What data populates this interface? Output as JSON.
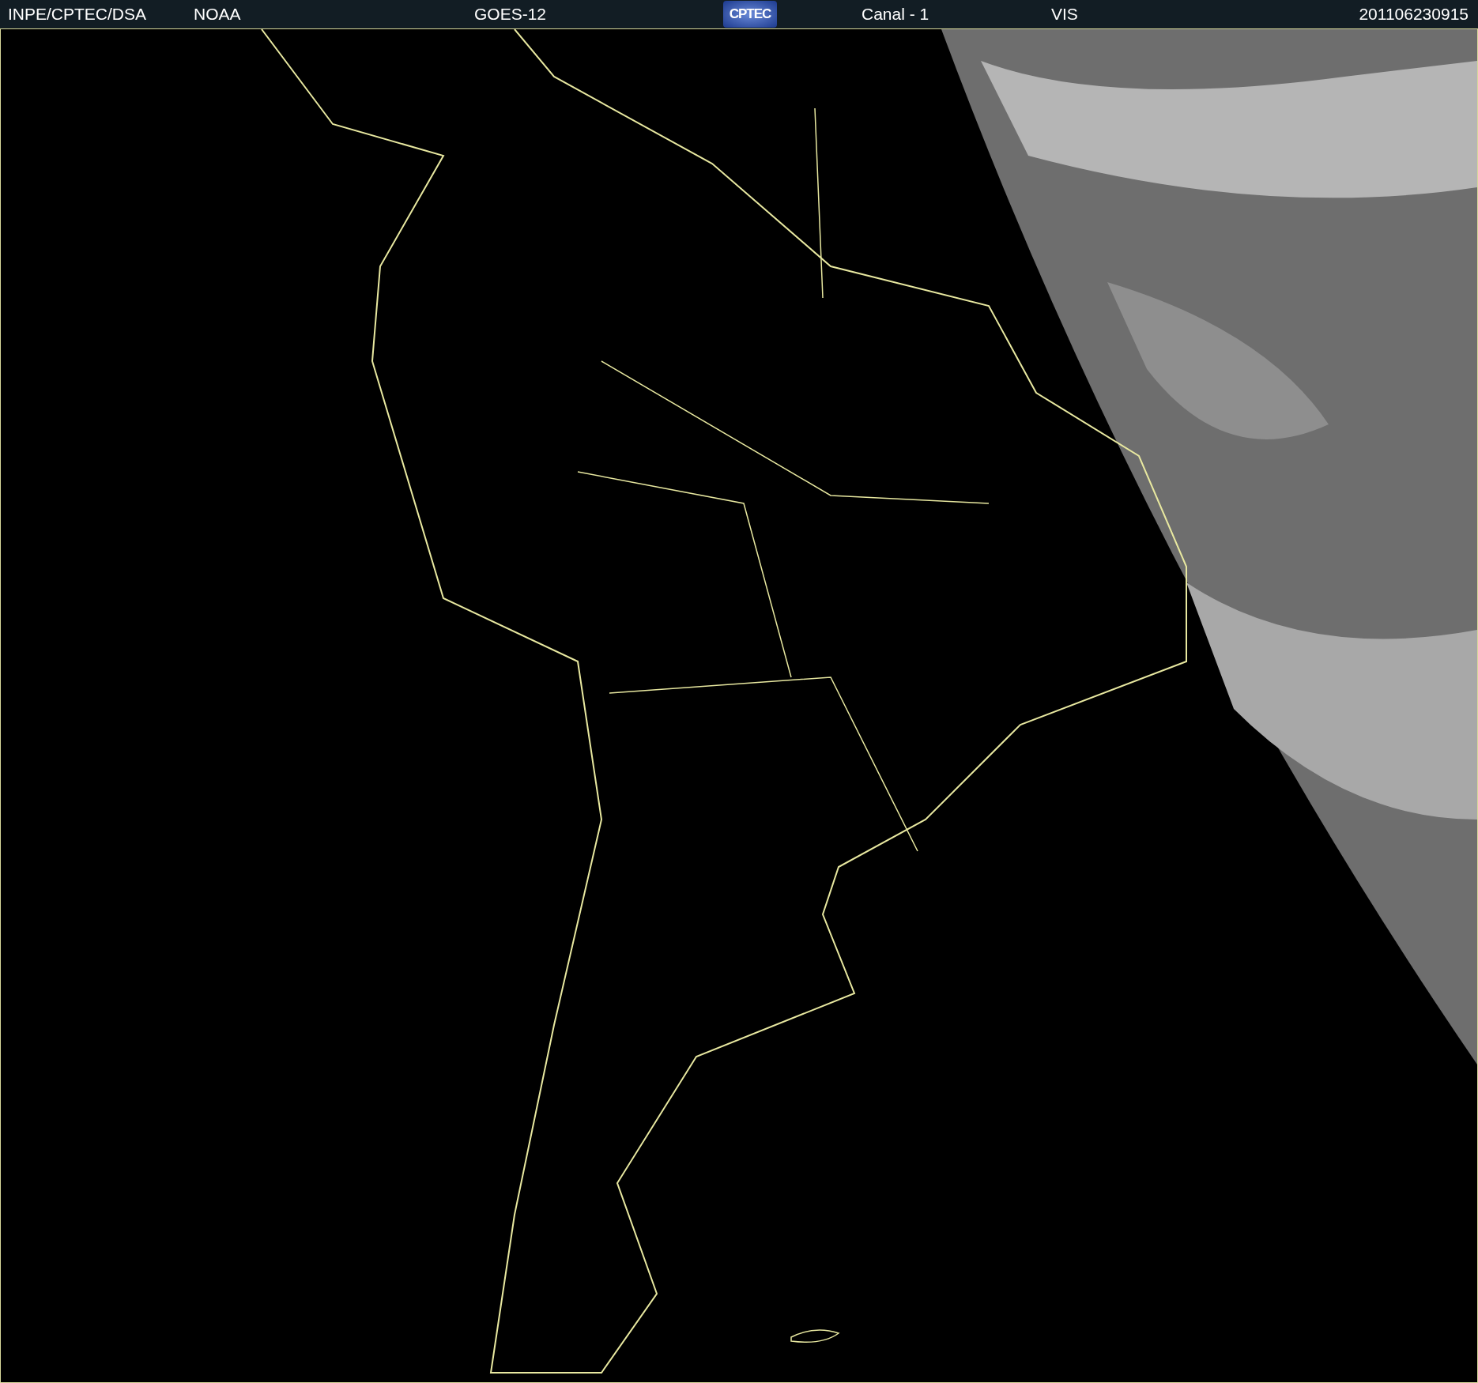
{
  "header": {
    "source": "INPE/CPTEC/DSA",
    "agency": "NOAA",
    "satellite": "GOES-12",
    "logo": "CPTEC",
    "channel": "Canal - 1",
    "band": "VIS",
    "timestamp": "201106230915"
  }
}
